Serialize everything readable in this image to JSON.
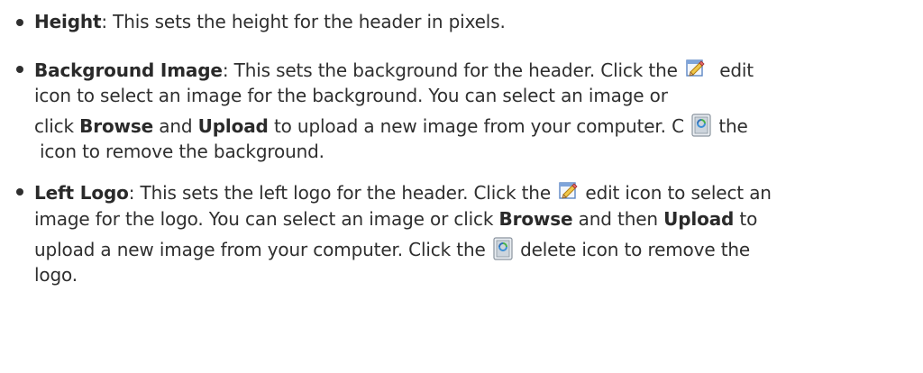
{
  "items": [
    {
      "term": "Height",
      "lines": [
        {
          "text_after_term": ": This sets the height for the header in pixels."
        }
      ]
    },
    {
      "term": "Background Image",
      "line1_after_term": ": This sets the background for the header. Click the",
      "line1_after_icon": "edit",
      "line2": "icon to select an image for the background. You can select an image or",
      "line3_pre": "click ",
      "line3_browse": "Browse",
      "line3_mid": " and ",
      "line3_upload": "Upload",
      "line3_after": " to upload a new image from your computer. C",
      "line3_end": " the",
      "line4": "icon to remove the background."
    },
    {
      "term": "Left Logo",
      "line1_after_term": ": This sets the left logo for the header. Click the",
      "line1_after_icon": " edit icon to select an",
      "line2_pre": "image for the logo. You can select an image or click ",
      "line2_browse": "Browse",
      "line2_mid": " and then ",
      "line2_upload": "Upload",
      "line2_end": " to",
      "line3_pre": "upload a new image from your computer. Click the",
      "line3_after_icon": " delete icon to remove the",
      "line4": "logo."
    }
  ],
  "icons": {
    "edit": "edit-icon",
    "delete": "delete-icon"
  }
}
